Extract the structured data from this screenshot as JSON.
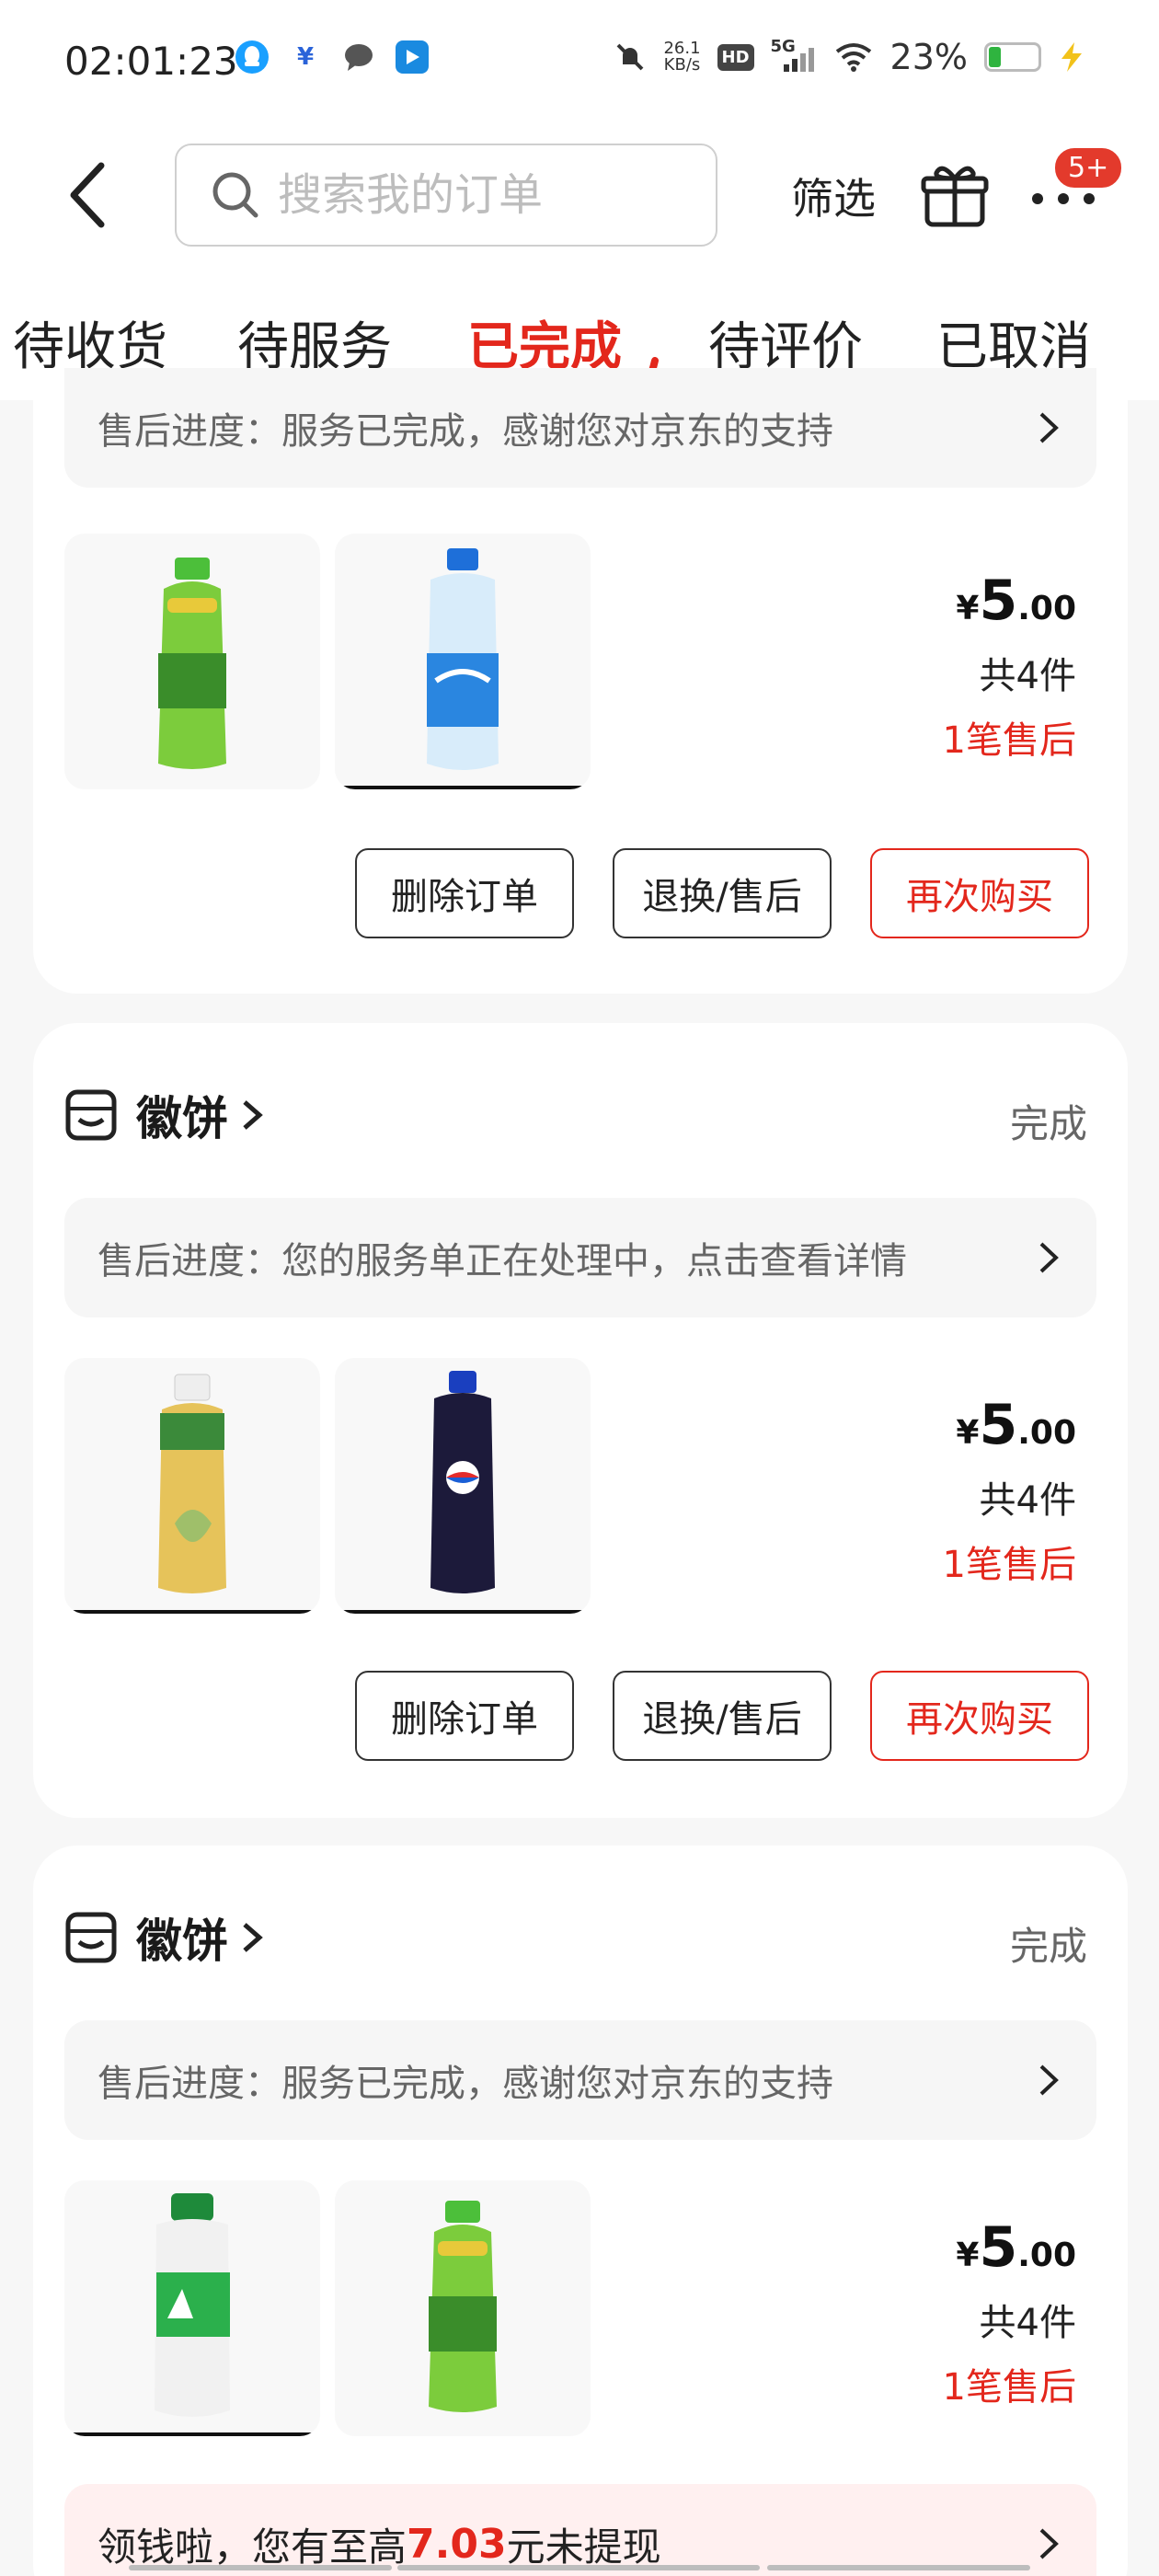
{
  "status_bar": {
    "time": "02:01:23",
    "net_speed_top": "26.1",
    "net_speed_bottom": "KB/s",
    "hd_label": "HD",
    "network": "5G",
    "battery_pct": "23%",
    "battery_level": 0.23
  },
  "header": {
    "search_placeholder": "搜索我的订单",
    "filter_label": "筛选",
    "badge": "5+"
  },
  "tabs": [
    {
      "label": "待收货",
      "active": false
    },
    {
      "label": "待服务",
      "active": false
    },
    {
      "label": "已完成",
      "active": true
    },
    {
      "label": "待评价",
      "active": false
    },
    {
      "label": "已取消",
      "active": false
    }
  ],
  "orders": [
    {
      "progress": "售后进度：服务已完成，感谢您对京东的支持",
      "price_symbol": "¥",
      "price_int": "5",
      "price_dec": ".00",
      "count": "共4件",
      "aftersale": "1笔售后",
      "buttons": {
        "delete": "删除订单",
        "return": "退换/售后",
        "rebuy": "再次购买"
      }
    },
    {
      "shop": "徽饼",
      "status": "完成",
      "progress": "售后进度：您的服务单正在处理中，点击查看详情",
      "price_symbol": "¥",
      "price_int": "5",
      "price_dec": ".00",
      "count": "共4件",
      "aftersale": "1笔售后",
      "buttons": {
        "delete": "删除订单",
        "return": "退换/售后",
        "rebuy": "再次购买"
      }
    },
    {
      "shop": "徽饼",
      "status": "完成",
      "progress": "售后进度：服务已完成，感谢您对京东的支持",
      "price_symbol": "¥",
      "price_int": "5",
      "price_dec": ".00",
      "count": "共4件",
      "aftersale": "1笔售后"
    }
  ],
  "promo": {
    "prefix": "领钱啦，您有至高",
    "amount": "7.03",
    "suffix": "元未提现"
  },
  "colors": {
    "accent": "#e3271c",
    "background": "#f7f7f7",
    "card": "#ffffff"
  }
}
